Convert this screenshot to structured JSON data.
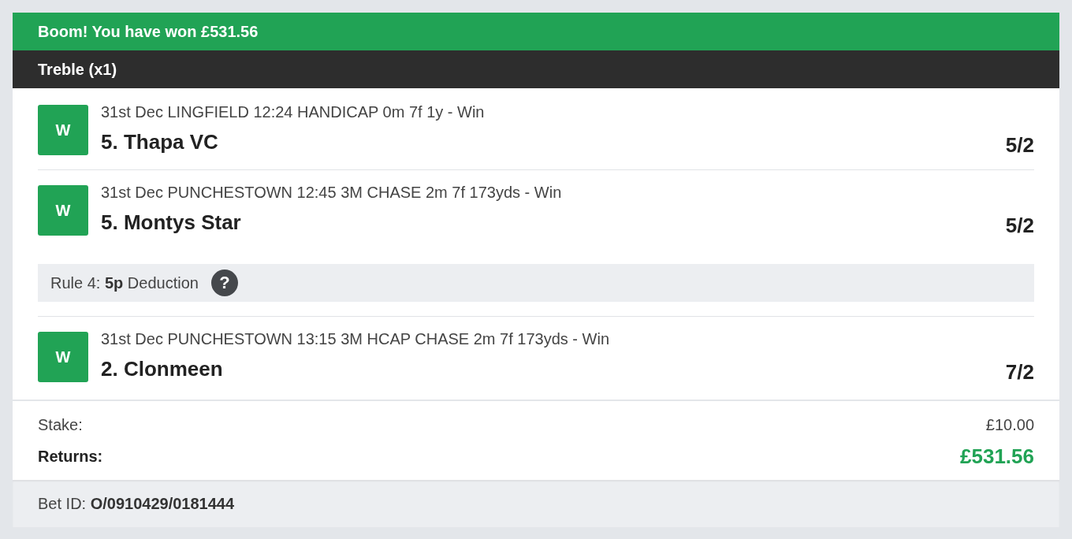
{
  "banner": {
    "message": "Boom! You have won £531.56"
  },
  "bet": {
    "title": "Treble (x1)"
  },
  "selections": [
    {
      "result": "W",
      "event": "31st Dec LINGFIELD 12:24 HANDICAP 0m 7f 1y - Win",
      "runner": "5. Thapa VC",
      "odds": "5/2"
    },
    {
      "result": "W",
      "event": "31st Dec PUNCHESTOWN 12:45 3M CHASE 2m 7f 173yds - Win",
      "runner": "5. Montys Star",
      "odds": "5/2",
      "notice": {
        "text": "Rule 4: **5p** Deduction",
        "help": "?"
      }
    },
    {
      "result": "W",
      "event": "31st Dec PUNCHESTOWN 13:15 3M HCAP CHASE 2m 7f 173yds - Win",
      "runner": "2. Clonmeen",
      "odds": "7/2"
    }
  ],
  "summary": {
    "stake_label": "Stake:",
    "stake": "£10.00",
    "returns_label": "Returns:",
    "returns": "£531.56"
  },
  "footer": {
    "bet_id": "Bet ID: **O/0910429/0181444**"
  }
}
